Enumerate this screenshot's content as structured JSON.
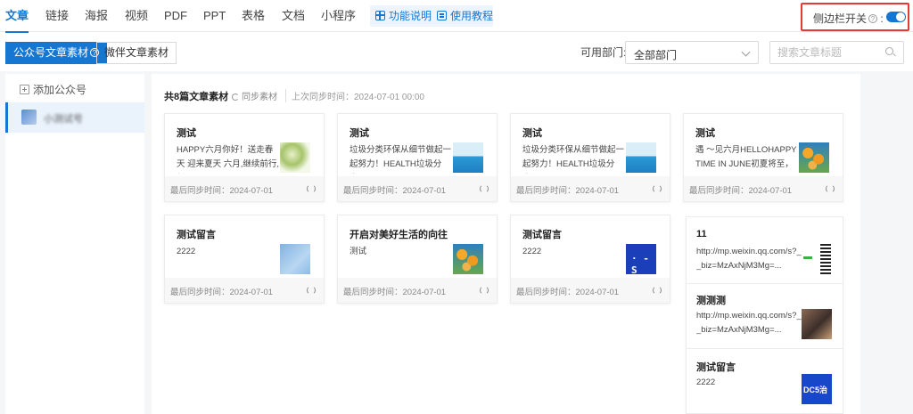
{
  "nav": {
    "tabs": [
      {
        "label": "文章",
        "active": true
      },
      {
        "label": "链接"
      },
      {
        "label": "海报"
      },
      {
        "label": "视频"
      },
      {
        "label": "PDF"
      },
      {
        "label": "PPT"
      },
      {
        "label": "表格"
      },
      {
        "label": "文档"
      },
      {
        "label": "小程序"
      }
    ],
    "help": {
      "features": "功能说明",
      "tutorial": "使用教程"
    },
    "sidebar_toggle": {
      "label": "侧边栏开关",
      "help": "?",
      "on": true
    }
  },
  "filters": {
    "segments": [
      "公众号文章素材",
      "微伴文章素材"
    ],
    "segment_help": "?",
    "dept_label": "可用部门:",
    "dept_value": "全部部门",
    "search_placeholder": "搜索文章标题"
  },
  "sidebar": {
    "add_label": "添加公众号",
    "account_name": "小测试号"
  },
  "summary": {
    "count_text": "共8篇文章素材",
    "sync_label": "同步素材",
    "last_sync": "上次同步时间：2024-07-01 00:00"
  },
  "cards": [
    {
      "title": "测试",
      "desc": "HAPPY六月你好！送走春天 迎来夏天 六月,继续前行,新...",
      "footer": "最后同步时间：2024-07-01",
      "thumb": "leaf"
    },
    {
      "title": "测试",
      "desc": "垃圾分类环保从细节做起一起努力！HEALTH垃圾分类...",
      "footer": "最后同步时间：2024-07-01",
      "thumb": "boat"
    },
    {
      "title": "测试",
      "desc": "垃圾分类环保从细节做起一起努力！HEALTH垃圾分类...",
      "footer": "最后同步时间：2024-07-01",
      "thumb": "boat"
    },
    {
      "title": "测试",
      "desc": "遇 ～见六月HELLOHAPPY TIME IN JUNE初夏将至，开...",
      "footer": "最后同步时间：2024-07-01",
      "thumb": "flower"
    },
    {
      "title": "测试留言",
      "desc": "2222",
      "footer": "最后同步时间：2024-07-01",
      "thumb": "sky"
    },
    {
      "title": "开启对美好生活的向往",
      "desc": "测试",
      "footer": "最后同步时间：2024-07-01",
      "thumb": "flower"
    },
    {
      "title": "测试留言",
      "desc": "2222",
      "footer": "最后同步时间：2024-07-01",
      "thumb": "blue"
    }
  ],
  "stack": [
    {
      "title": "11",
      "desc": "http://mp.weixin.qq.com/s?_ _biz=MzAxNjM3Mg=...",
      "thumb": "qr"
    },
    {
      "title": "测测测",
      "desc": "http://mp.weixin.qq.com/s?_ _biz=MzAxNjM3Mg=...",
      "thumb": "person"
    },
    {
      "title": "测试留言",
      "desc": "2222",
      "thumb": "blue2"
    }
  ],
  "colors": {
    "accent": "#1677d2",
    "highlight_border": "#e53935"
  }
}
